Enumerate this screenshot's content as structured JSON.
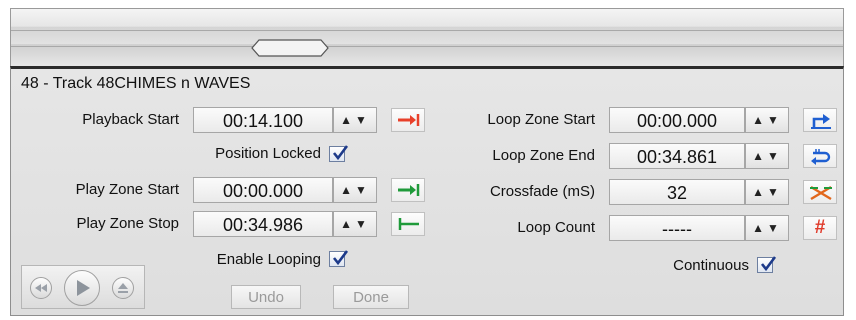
{
  "track_title": "48 - Track 48CHIMES n WAVES",
  "left": {
    "playback_start": {
      "label": "Playback Start",
      "value": "00:14.100",
      "icon": "jump-to-start-icon",
      "color": "#e8402a"
    },
    "position_locked": {
      "label": "Position Locked",
      "checked": true
    },
    "play_zone_start": {
      "label": "Play Zone Start",
      "value": "00:00.000",
      "icon": "set-zone-start-icon",
      "color": "#1f9a3a"
    },
    "play_zone_stop": {
      "label": "Play Zone Stop",
      "value": "00:34.986",
      "icon": "set-zone-stop-icon",
      "color": "#1f9a3a"
    },
    "enable_looping": {
      "label": "Enable Looping",
      "checked": true
    }
  },
  "right": {
    "loop_zone_start": {
      "label": "Loop Zone Start",
      "value": "00:00.000",
      "icon": "loop-start-icon",
      "color": "#1f5fd1"
    },
    "loop_zone_end": {
      "label": "Loop Zone End",
      "value": "00:34.861",
      "icon": "loop-end-icon",
      "color": "#1f5fd1"
    },
    "crossfade": {
      "label": "Crossfade (mS)",
      "value": "32",
      "icon": "crossfade-icon",
      "color": "#e2671b"
    },
    "loop_count": {
      "label": "Loop Count",
      "value": "-----",
      "icon": "hash-icon",
      "glyph": "#",
      "color": "#e03a2a"
    },
    "continuous": {
      "label": "Continuous",
      "checked": true
    }
  },
  "buttons": {
    "undo": "Undo",
    "done": "Done"
  },
  "spin_glyph": "▲▼",
  "transport": [
    "rewind-icon",
    "play-icon",
    "eject-icon"
  ]
}
